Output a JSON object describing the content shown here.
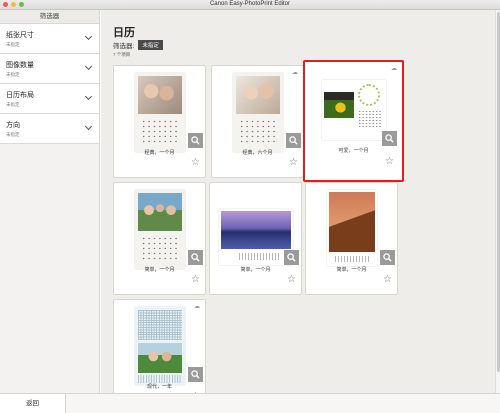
{
  "window": {
    "title": "Canon Easy-PhotoPrint Editor"
  },
  "sidebar": {
    "header": "筛选器",
    "filters": [
      {
        "name": "纸张尺寸",
        "value": "未指定"
      },
      {
        "name": "图像数量",
        "value": "未指定"
      },
      {
        "name": "日历布局",
        "value": "未指定"
      },
      {
        "name": "方向",
        "value": "未指定"
      }
    ]
  },
  "main": {
    "title": "日历",
    "filter_label": "筛选器:",
    "filter_value": "未指定",
    "count": "7 个项目",
    "items": [
      {
        "label": "经典，一个月"
      },
      {
        "label": "经典，六个月"
      },
      {
        "label": "可爱，一个月"
      },
      {
        "label": "简单，一个月"
      },
      {
        "label": "简单，一个月"
      },
      {
        "label": "简单，一个月"
      },
      {
        "label": "现代，一年"
      }
    ]
  },
  "footer": {
    "back_label": "返回"
  },
  "colors": {
    "selection": "#e01e1e",
    "panel": "#efede9",
    "zoom_button": "#9a9a9a"
  }
}
